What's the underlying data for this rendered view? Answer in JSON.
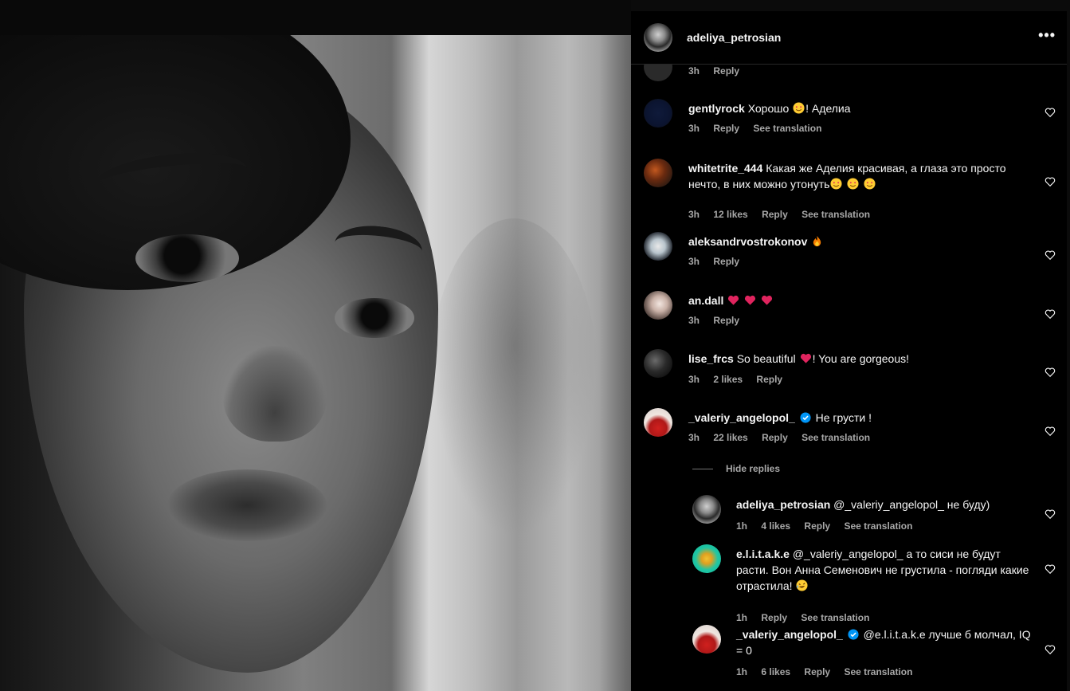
{
  "post": {
    "author": "adeliya_petrosian",
    "more_label": "•••"
  },
  "top_partial": {
    "time": "3h",
    "reply": "Reply"
  },
  "comments": [
    {
      "user": "gentlyrock",
      "text_before": " Хорошо ",
      "emojis": [
        "heart-eyes"
      ],
      "text_after": "! Аделиа",
      "time": "3h",
      "likes": "",
      "reply": "Reply",
      "translation": "See translation"
    },
    {
      "user": "whitetrite_444",
      "text_before": " Какая же Аделия красивая, а глаза это просто нечто, в них можно утонуть",
      "emojis": [
        "heart-eyes",
        "heart-eyes",
        "heart-eyes"
      ],
      "text_after": "",
      "time": "3h",
      "likes": "12 likes",
      "reply": "Reply",
      "translation": "See translation"
    },
    {
      "user": "aleksandrvostrokonov",
      "text_before": " ",
      "emojis": [
        "fire"
      ],
      "text_after": "",
      "time": "3h",
      "likes": "",
      "reply": "Reply",
      "translation": ""
    },
    {
      "user": "an.dall",
      "text_before": " ",
      "emojis": [
        "red-heart",
        "red-heart",
        "red-heart"
      ],
      "text_after": "",
      "time": "3h",
      "likes": "",
      "reply": "Reply",
      "translation": ""
    },
    {
      "user": "lise_frcs",
      "text_before": " So beautiful ",
      "emojis": [
        "red-heart"
      ],
      "text_after": "! You are gorgeous!",
      "time": "3h",
      "likes": "2 likes",
      "reply": "Reply",
      "translation": ""
    },
    {
      "user": "_valeriy_angelopol_",
      "verified": true,
      "text_before": " Не грусти !",
      "emojis": [],
      "text_after": "",
      "time": "3h",
      "likes": "22 likes",
      "reply": "Reply",
      "translation": "See translation"
    }
  ],
  "hide_replies": "Hide replies",
  "replies": [
    {
      "user": "adeliya_petrosian",
      "text": " @_valeriy_angelopol_ не буду)",
      "time": "1h",
      "likes": "4 likes",
      "reply": "Reply",
      "translation": "See translation"
    },
    {
      "user": "e.l.i.t.a.k.e",
      "text_before": " @_valeriy_angelopol_ а то сиси не будут расти. Вон Анна Семенович не грустила - погляди какие отрастила! ",
      "emojis": [
        "rofl"
      ],
      "time": "1h",
      "likes": "",
      "reply": "Reply",
      "translation": "See translation"
    },
    {
      "user": "_valeriy_angelopol_",
      "verified": true,
      "text": " @e.l.i.t.a.k.e лучше б молчал, IQ = 0",
      "time": "1h",
      "likes": "6 likes",
      "reply": "Reply",
      "translation": "See translation"
    }
  ],
  "colors": {
    "background": "#000000",
    "muted": "#a8a8a8",
    "verified": "#0095f6",
    "heart": "#ed4956"
  }
}
